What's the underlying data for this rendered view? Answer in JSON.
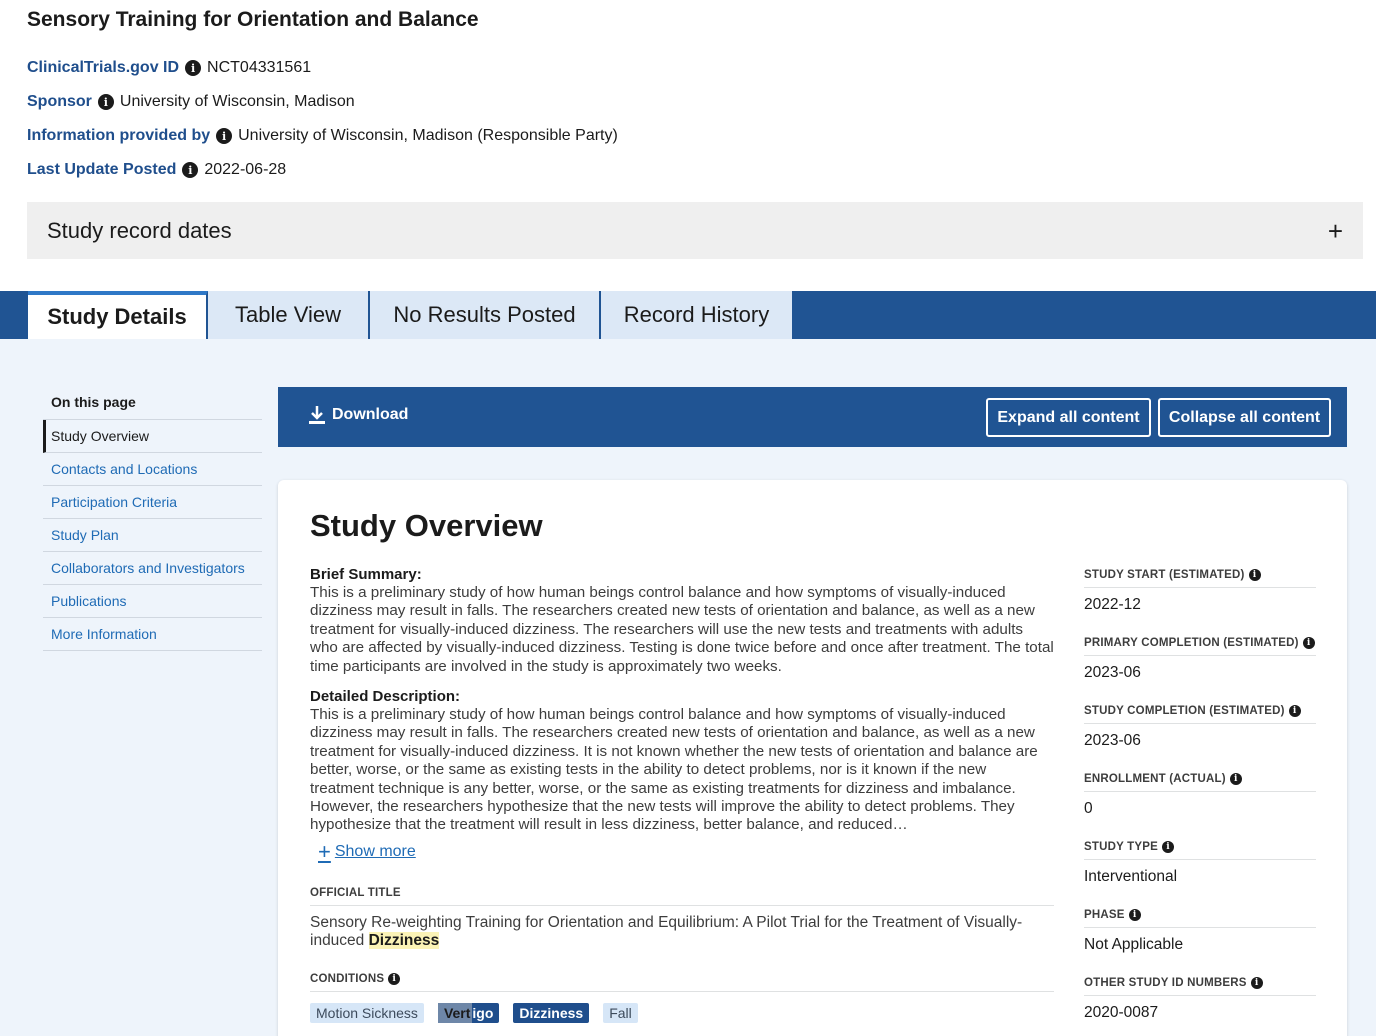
{
  "study": {
    "title": "Sensory Training for Orientation and Balance",
    "meta": [
      {
        "label": "ClinicalTrials.gov ID",
        "value": "NCT04331561"
      },
      {
        "label": "Sponsor",
        "value": "University of Wisconsin, Madison"
      },
      {
        "label": "Information provided by",
        "value": "University of Wisconsin, Madison (Responsible Party)"
      },
      {
        "label": "Last Update Posted",
        "value": "2022-06-28"
      }
    ],
    "record_dates_label": "Study record dates"
  },
  "tabs": [
    {
      "label": "Study Details"
    },
    {
      "label": "Table View"
    },
    {
      "label": "No Results Posted"
    },
    {
      "label": "Record History"
    }
  ],
  "nav": {
    "heading": "On this page",
    "items": [
      {
        "label": "Study Overview"
      },
      {
        "label": "Contacts and Locations"
      },
      {
        "label": "Participation Criteria"
      },
      {
        "label": "Study Plan"
      },
      {
        "label": "Collaborators and Investigators"
      },
      {
        "label": "Publications"
      },
      {
        "label": "More Information"
      }
    ]
  },
  "toolbar": {
    "download_label": "Download",
    "expand_label": "Expand all content",
    "collapse_label": "Collapse all content"
  },
  "overview": {
    "heading": "Study Overview",
    "brief_summary_label": "Brief Summary:",
    "brief_summary": "This is a preliminary study of how human beings control balance and how symptoms of visually-induced dizziness may result in falls. The researchers created new tests of orientation and balance, as well as a new treatment for visually-induced dizziness. The researchers will use the new tests and treatments with adults who are affected by visually-induced dizziness. Testing is done twice before and once after treatment. The total time participants are involved in the study is approximately two weeks.",
    "detailed_description_label": "Detailed Description:",
    "detailed_description": "This is a preliminary study of how human beings control balance and how symptoms of visually-induced dizziness may result in falls. The researchers created new tests of orientation and balance, as well as a new treatment for visually-induced dizziness. It is not known whether the new tests of orientation and balance are better, worse, or the same as existing tests in the ability to detect problems, nor is it known if the new treatment technique is any better, worse, or the same as existing treatments for dizziness and imbalance. However, the researchers hypothesize that the new tests will improve the ability to detect problems. They hypothesize that the treatment will result in less dizziness, better balance, and reduced…",
    "show_more_label": "Show more",
    "official_title_label": "OFFICIAL TITLE",
    "official_title_text": "Sensory Re-weighting Training for Orientation and Equilibrium: A Pilot Trial for the Treatment of Visually-induced ",
    "official_title_highlight": "Dizziness",
    "conditions_label": "CONDITIONS",
    "conditions": {
      "c1": "Motion Sickness",
      "c2_selected": "Vert",
      "c2_rest": "igo",
      "c3": "Dizziness",
      "c4": "Fall"
    }
  },
  "facts": [
    {
      "label": "STUDY START (ESTIMATED)",
      "value": "2022-12"
    },
    {
      "label": "PRIMARY COMPLETION (ESTIMATED)",
      "value": "2023-06"
    },
    {
      "label": "STUDY COMPLETION (ESTIMATED)",
      "value": "2023-06"
    },
    {
      "label": "ENROLLMENT (ACTUAL)",
      "value": "0"
    },
    {
      "label": "STUDY TYPE",
      "value": "Interventional"
    },
    {
      "label": "PHASE",
      "value": "Not Applicable"
    },
    {
      "label": "OTHER STUDY ID NUMBERS",
      "value": "2020-0087"
    }
  ],
  "colors": {
    "primary_blue": "#205493",
    "link_blue": "#1f6bb5",
    "label_blue": "#1f4e8c",
    "highlight_yellow": "#fbf3b6"
  }
}
